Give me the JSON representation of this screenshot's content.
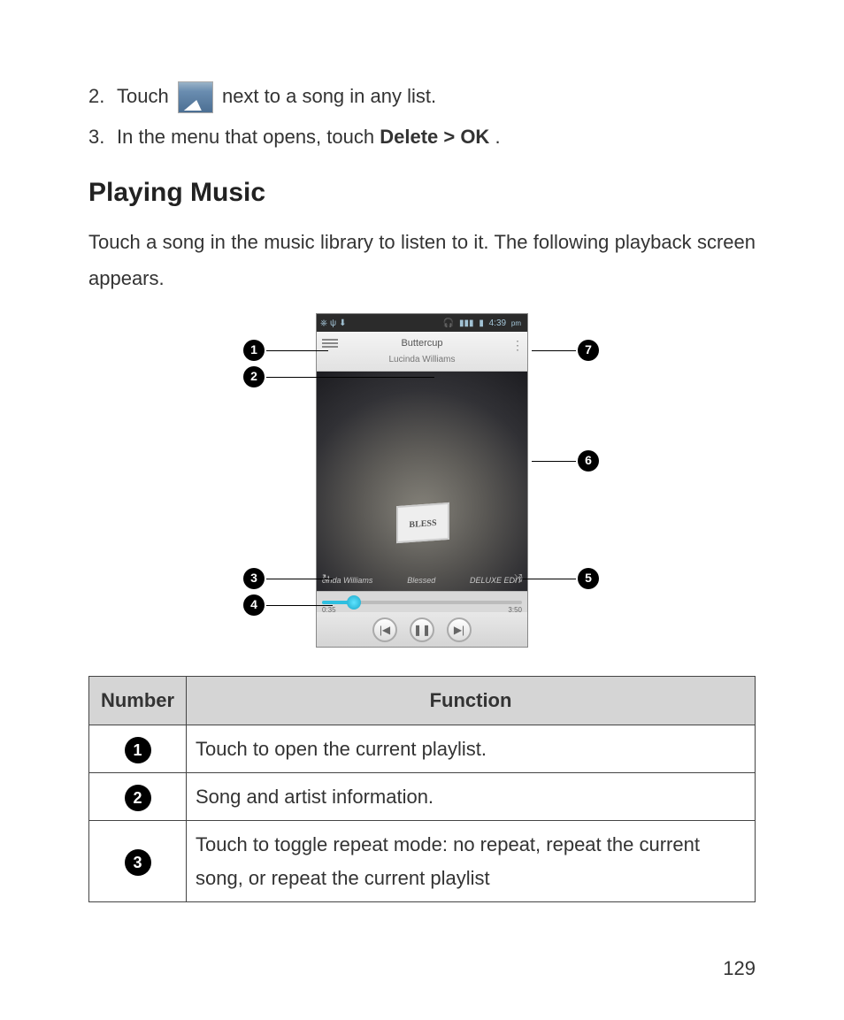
{
  "steps": [
    {
      "num": "2.",
      "before": "Touch ",
      "after": " next to a song in any list."
    },
    {
      "num": "3.",
      "text_before": "In the menu that opens, touch ",
      "bold": "Delete > OK",
      "text_after": "."
    }
  ],
  "heading": "Playing Music",
  "intro": "Touch a song in the music library to listen to it. The following playback screen appears.",
  "phone": {
    "status_time": "4:39",
    "status_pm": "pm",
    "song": "Buttercup",
    "artist": "Lucinda Williams",
    "art_caption_left": "cinda Williams",
    "art_caption_center": "Blessed",
    "art_caption_right": "DELUXE EDIT",
    "sign_text": "BLESS",
    "time_elapsed": "0:35",
    "time_total": "3:50"
  },
  "callouts": {
    "1": "1",
    "2": "2",
    "3": "3",
    "4": "4",
    "5": "5",
    "6": "6",
    "7": "7"
  },
  "table": {
    "head_num": "Number",
    "head_func": "Function",
    "rows": [
      {
        "n": "1",
        "f": "Touch to open the current playlist."
      },
      {
        "n": "2",
        "f": "Song and artist information."
      },
      {
        "n": "3",
        "f": "Touch to toggle repeat mode: no repeat, repeat the current song, or repeat the current playlist"
      }
    ]
  },
  "page_number": "129"
}
